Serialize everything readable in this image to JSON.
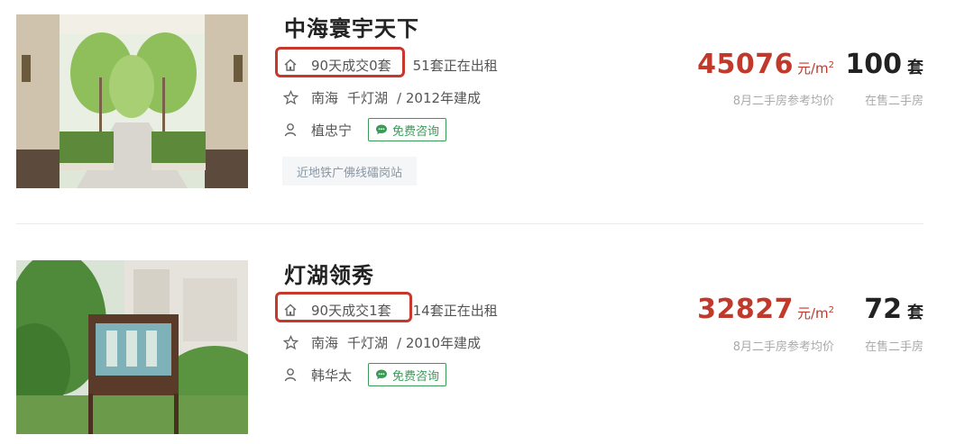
{
  "listings": [
    {
      "name": "中海寰宇天下",
      "deals_90d": "90天成交0套",
      "renting": "51套正在出租",
      "district": "南海",
      "area": "千灯湖",
      "built": "/ 2012年建成",
      "agent": "植忠宁",
      "consult_label": "免费咨询",
      "tag": "近地铁广佛线礌岗站",
      "price": "45076",
      "price_unit": "元/m",
      "price_unit_sup": "2",
      "price_label": "8月二手房参考均价",
      "count": "100",
      "count_unit": "套",
      "count_label": "在售二手房"
    },
    {
      "name": "灯湖领秀",
      "deals_90d": "90天成交1套",
      "renting": "14套正在出租",
      "district": "南海",
      "area": "千灯湖",
      "built": "/ 2010年建成",
      "agent": "韩华太",
      "consult_label": "免费咨询",
      "price": "32827",
      "price_unit": "元/m",
      "price_unit_sup": "2",
      "price_label": "8月二手房参考均价",
      "count": "72",
      "count_unit": "套",
      "count_label": "在售二手房"
    }
  ],
  "colors": {
    "price": "#c0392b",
    "highlight_box": "#c8372d",
    "consult": "#3a9a58"
  },
  "icons": [
    "home-icon",
    "star-icon",
    "person-icon",
    "chat-bubble-icon"
  ]
}
